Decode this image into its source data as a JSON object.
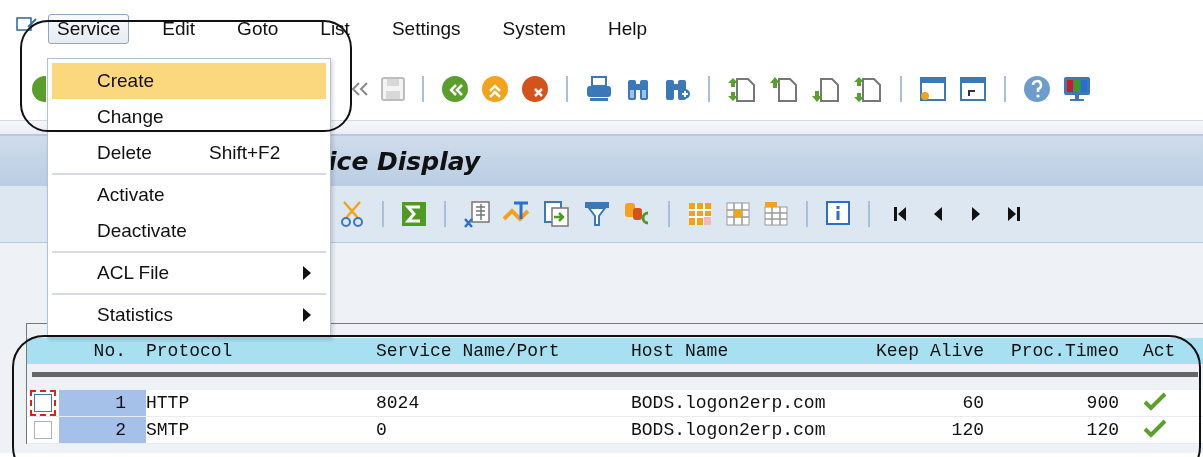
{
  "menu_bar": {
    "items": [
      {
        "label": "Service",
        "selected": true
      },
      {
        "label": "Edit",
        "selected": false
      },
      {
        "label": "Goto",
        "selected": false
      },
      {
        "label": "List",
        "selected": false
      },
      {
        "label": "Settings",
        "selected": false
      },
      {
        "label": "System",
        "selected": false
      },
      {
        "label": "Help",
        "selected": false
      }
    ]
  },
  "dropdown": {
    "groups": [
      [
        {
          "label": "Create",
          "selected": true,
          "submenu": false
        },
        {
          "label": "Change",
          "selected": false,
          "submenu": false
        },
        {
          "label": "Delete",
          "shortcut": "Shift+F2",
          "selected": false,
          "submenu": false
        }
      ],
      [
        {
          "label": "Activate",
          "selected": false,
          "submenu": false
        },
        {
          "label": "Deactivate",
          "selected": false,
          "submenu": false
        }
      ],
      [
        {
          "label": "ACL File",
          "selected": false,
          "submenu": true
        }
      ],
      [
        {
          "label": "Statistics",
          "selected": false,
          "submenu": true
        }
      ]
    ]
  },
  "title": "ice Display",
  "table": {
    "columns": [
      "No.",
      "Protocol",
      "Service Name/Port",
      "Host Name",
      "Keep Alive",
      "Proc.Timeo",
      "Act"
    ],
    "rows": [
      {
        "selected": false,
        "focused": true,
        "active": true,
        "cells": [
          "1",
          "HTTP",
          "8024",
          "BODS.logon2erp.com",
          "60",
          "900"
        ]
      },
      {
        "selected": false,
        "focused": false,
        "active": true,
        "cells": [
          "2",
          "SMTP",
          "0",
          "BODS.logon2erp.com",
          "120",
          "120"
        ]
      }
    ]
  }
}
